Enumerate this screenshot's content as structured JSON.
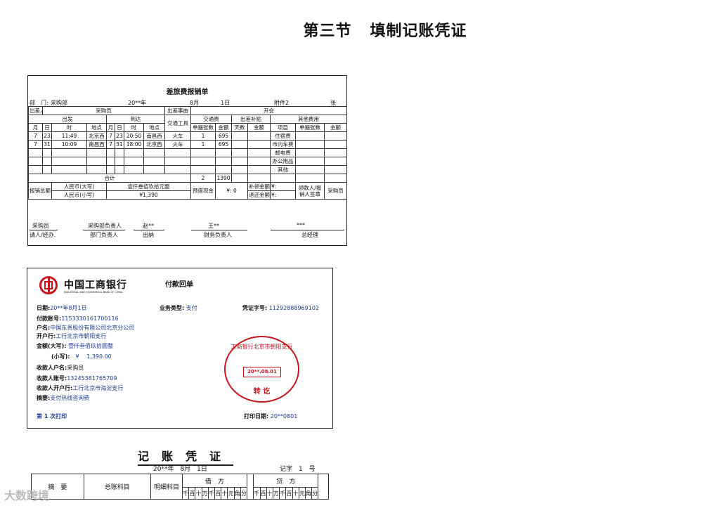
{
  "heading": {
    "section": "第三节",
    "title": "填制记账凭证"
  },
  "travel": {
    "title": "差旅费报销单",
    "dept_label": "部　门:",
    "dept": "采购部",
    "year": "20**年",
    "month": "8月",
    "day": "1日",
    "attach": "附件2",
    "attach_unit": "张",
    "traveler_label": "出差人",
    "traveler": "采购员",
    "reason_label": "出差事由",
    "reason": "开会",
    "depart": "出发",
    "arrive": "到达",
    "transport_tool": "交通工具",
    "transport_fee": "交通费",
    "allowance": "出差补贴",
    "other_fee": "其他费用",
    "cols": [
      "月",
      "日",
      "时",
      "地点",
      "月",
      "日",
      "时",
      "地点",
      "单据张数",
      "金额",
      "天数",
      "金额",
      "项目",
      "单据张数",
      "金额"
    ],
    "rows": [
      [
        "7",
        "23",
        "11:49",
        "北京西",
        "7",
        "23",
        "20:50",
        "南昌西",
        "火车",
        "1",
        "695",
        "",
        "",
        "住宿费",
        "",
        ""
      ],
      [
        "7",
        "31",
        "10:09",
        "南昌西",
        "7",
        "31",
        "18:00",
        "北京西",
        "火车",
        "1",
        "695",
        "",
        "",
        "市内车费",
        "",
        ""
      ],
      [
        "",
        "",
        "",
        "",
        "",
        "",
        "",
        "",
        "",
        "",
        "",
        "",
        "",
        "邮电费",
        "",
        ""
      ],
      [
        "",
        "",
        "",
        "",
        "",
        "",
        "",
        "",
        "",
        "",
        "",
        "",
        "",
        "办公用品",
        "",
        ""
      ],
      [
        "",
        "",
        "",
        "",
        "",
        "",
        "",
        "",
        "",
        "",
        "",
        "",
        "",
        "其他",
        "",
        ""
      ]
    ],
    "total_label": "合计",
    "total_count": "2",
    "total_amount": "1390",
    "reimb_total": "报销总额",
    "rmb_upper_label": "人民币(大写)",
    "rmb_upper": "壹仟叁佰玖拾元整",
    "rmb_lower_label": "人民币(小写)",
    "rmb_lower": "¥1,390",
    "cash_adv_label": "预借现金",
    "cash_adv": "¥: 0",
    "supp_label": "补领金额",
    "supp": "¥:",
    "refund_label": "退还金额",
    "refund": "¥:",
    "receiver_label": "领款人/报销人签章",
    "receiver": "采购员",
    "sig": {
      "applicant_val": "采购员",
      "applicant": "请人/经办.",
      "dept_head_val": "采购部负责人",
      "dept_head": "部门负责人",
      "cashier_val": "赵**",
      "cashier": "出纳",
      "finance_val": "王**",
      "finance": "财务负责人",
      "gm_val": "***",
      "gm": "总经理"
    }
  },
  "bank": {
    "bank_name": "中国工商银行",
    "bank_en": "INDUSTRIAL AND COMMERCIAL BANK OF CHINA",
    "title": "付款回单",
    "date_label": "日期:",
    "date": "20**年8月1日",
    "type_label": "业务类型:",
    "type": "支付",
    "voucher_label": "凭证字号:",
    "voucher": "11292888969102",
    "payer_acct_label": "付款账号:",
    "payer_acct": "1153330161700116",
    "payer_name_label": "户名:",
    "payer_name": "中国东贵股份有限公司北京分公司",
    "payer_bank_label": "开户行:",
    "payer_bank": "工行北京市朝阳支行",
    "amount_upper_label": "金额(大写):",
    "amount_upper": "壹仟叁佰玖拾圆整",
    "amount_lower_label": "(小写):",
    "amount_lower": "¥　 1,390.00",
    "payee_name_label": "收款人户名:",
    "payee_name": "采购员",
    "payee_acct_label": "收款人账号:",
    "payee_acct": "13245381765709",
    "payee_bank_label": "收款人开户行:",
    "payee_bank": "工行北京市海淀支行",
    "memo_label": "摘要:",
    "memo": "支付热线咨询费",
    "print_count": "第 1 次打印",
    "print_date_label": "打印日期:",
    "print_date": "20**0801",
    "stamp_arc": "工商银行北京市朝阳支行",
    "stamp_date": "20**.08.01",
    "stamp_done": "转 讫"
  },
  "voucher": {
    "title": "记账凭证",
    "date": "20**年　8月　1日",
    "number": "记字　1　号",
    "summary": "摘　要",
    "account": "总账科目",
    "detail": "明细科目",
    "debit": "借　方",
    "credit": "贷　方",
    "digits": [
      "千",
      "百",
      "十",
      "万",
      "千",
      "百",
      "十",
      "元",
      "角",
      "分"
    ]
  },
  "watermark": "大数跨境"
}
